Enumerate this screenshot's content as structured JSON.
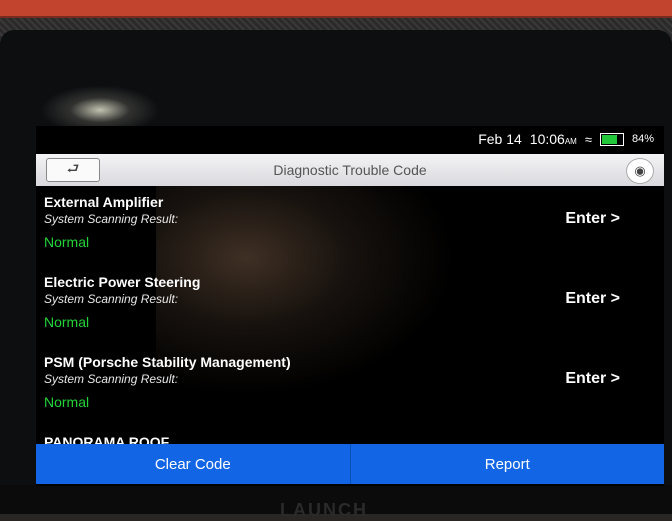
{
  "status_bar": {
    "date": "Feb 14",
    "time": "10:06",
    "time_suffix": "AM",
    "battery": "84%",
    "battery_level": 0.84
  },
  "header": {
    "title": "Diagnostic Trouble Code",
    "back_icon": "back-arrow-icon",
    "screenshot_icon": "camera-icon"
  },
  "modules": [
    {
      "name": "External Amplifier",
      "scan_label": "System Scanning Result:",
      "result": "Normal",
      "action": "Enter >"
    },
    {
      "name": "Electric Power Steering",
      "scan_label": "System Scanning Result:",
      "result": "Normal",
      "action": "Enter >"
    },
    {
      "name": "PSM (Porsche Stability Management)",
      "scan_label": "System Scanning Result:",
      "result": "Normal",
      "action": "Enter >"
    },
    {
      "name": "PANORAMA ROOF"
    }
  ],
  "footer": {
    "clear_code": "Clear Code",
    "report": "Report"
  },
  "device": {
    "brand": "LAUNCH"
  },
  "colors": {
    "accent": "#1266e6",
    "normal_status": "#22d438"
  }
}
